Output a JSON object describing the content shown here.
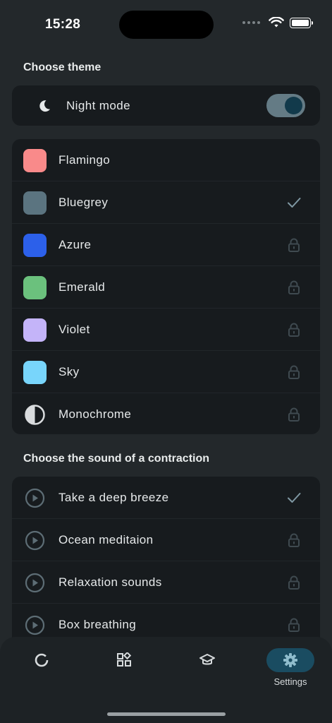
{
  "status_bar": {
    "time": "15:28"
  },
  "theme_section": {
    "title": "Choose theme",
    "night_mode": {
      "label": "Night mode",
      "enabled": true
    }
  },
  "themes": [
    {
      "label": "Flamingo",
      "color": "#f98a8a",
      "state": "none"
    },
    {
      "label": "Bluegrey",
      "color": "#5b7480",
      "state": "selected"
    },
    {
      "label": "Azure",
      "color": "#2c60ea",
      "state": "locked"
    },
    {
      "label": "Emerald",
      "color": "#6bc17d",
      "state": "locked"
    },
    {
      "label": "Violet",
      "color": "#c4b4f9",
      "state": "locked"
    },
    {
      "label": "Sky",
      "color": "#78d5fb",
      "state": "locked"
    },
    {
      "label": "Monochrome",
      "color": "#d9dcde",
      "state": "locked"
    }
  ],
  "sound_section": {
    "title": "Choose the sound of a contraction"
  },
  "sounds": [
    {
      "label": "Take a deep breeze",
      "state": "selected"
    },
    {
      "label": "Ocean meditaion",
      "state": "locked"
    },
    {
      "label": "Relaxation sounds",
      "state": "locked"
    },
    {
      "label": "Box breathing",
      "state": "locked"
    }
  ],
  "tabbar": {
    "tabs": [
      {
        "icon": "progress-ring-icon",
        "label": ""
      },
      {
        "icon": "grid-icon",
        "label": ""
      },
      {
        "icon": "graduation-cap-icon",
        "label": ""
      },
      {
        "icon": "gear-icon",
        "label": "Settings",
        "active": true
      }
    ]
  },
  "colors": {
    "background": "#23282b",
    "card": "#171b1e",
    "accent": "#1a4c61",
    "toggle_track": "#647b85",
    "muted_icon": "#5d6d75"
  }
}
